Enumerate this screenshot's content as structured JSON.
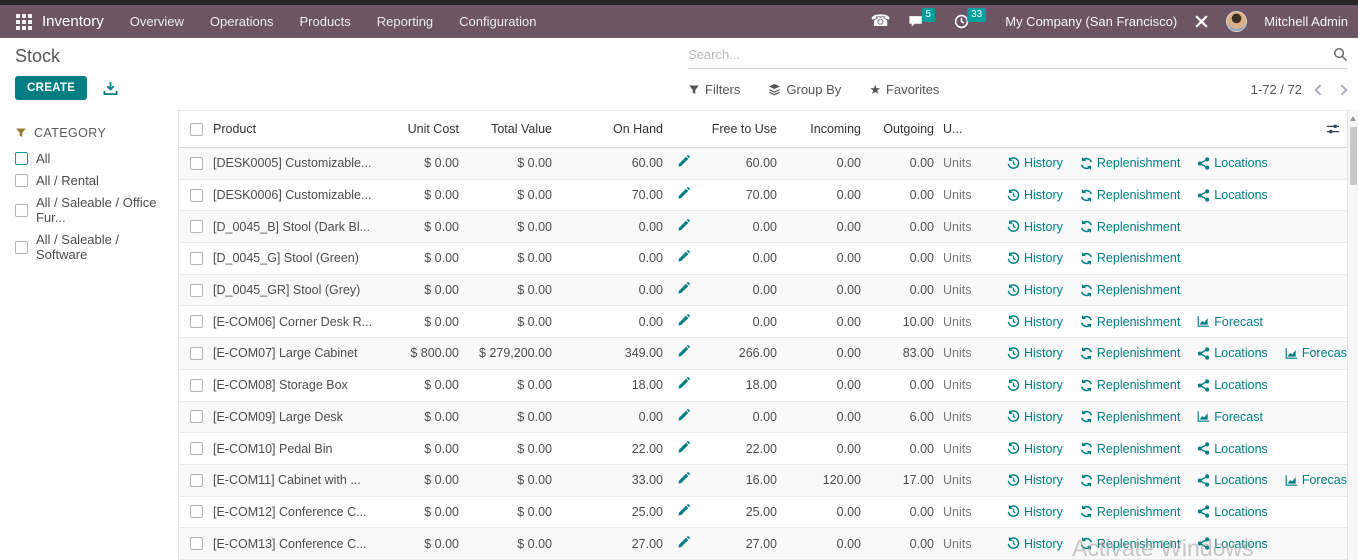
{
  "colors": {
    "topbar": "#6d5566",
    "accent": "#017e84",
    "badge": "#00a09d",
    "gold": "#9a7b2d"
  },
  "topbar": {
    "app_name": "Inventory",
    "menus": [
      "Overview",
      "Operations",
      "Products",
      "Reporting",
      "Configuration"
    ],
    "messages_badge": "5",
    "activities_badge": "33",
    "company": "My Company (San Francisco)",
    "user": "Mitchell Admin"
  },
  "control_panel": {
    "title": "Stock",
    "create_label": "CREATE",
    "search_placeholder": "Search...",
    "filters_label": "Filters",
    "group_by_label": "Group By",
    "favorites_label": "Favorites",
    "pager": "1-72 / 72"
  },
  "sidebar": {
    "title": "CATEGORY",
    "items": [
      {
        "label": "All"
      },
      {
        "label": "All / Rental"
      },
      {
        "label": "All / Saleable / Office Fur..."
      },
      {
        "label": "All / Saleable / Software"
      }
    ]
  },
  "table": {
    "columns": {
      "product": "Product",
      "unit_cost": "Unit Cost",
      "total_value": "Total Value",
      "on_hand": "On Hand",
      "free_to_use": "Free to Use",
      "incoming": "Incoming",
      "outgoing": "Outgoing",
      "uom": "U..."
    },
    "uom_value": "Units",
    "action_labels": {
      "history": "History",
      "replenishment": "Replenishment",
      "locations": "Locations",
      "forecast": "Forecast"
    },
    "rows": [
      {
        "product": "[DESK0005] Customizable...",
        "unit_cost": "$ 0.00",
        "total_value": "$ 0.00",
        "on_hand": "60.00",
        "free_to_use": "60.00",
        "incoming": "0.00",
        "outgoing": "0.00",
        "actions": [
          "history",
          "replenishment",
          "locations"
        ]
      },
      {
        "product": "[DESK0006] Customizable...",
        "unit_cost": "$ 0.00",
        "total_value": "$ 0.00",
        "on_hand": "70.00",
        "free_to_use": "70.00",
        "incoming": "0.00",
        "outgoing": "0.00",
        "actions": [
          "history",
          "replenishment",
          "locations"
        ]
      },
      {
        "product": "[D_0045_B] Stool (Dark Bl...",
        "unit_cost": "$ 0.00",
        "total_value": "$ 0.00",
        "on_hand": "0.00",
        "free_to_use": "0.00",
        "incoming": "0.00",
        "outgoing": "0.00",
        "actions": [
          "history",
          "replenishment"
        ]
      },
      {
        "product": "[D_0045_G] Stool (Green)",
        "unit_cost": "$ 0.00",
        "total_value": "$ 0.00",
        "on_hand": "0.00",
        "free_to_use": "0.00",
        "incoming": "0.00",
        "outgoing": "0.00",
        "actions": [
          "history",
          "replenishment"
        ]
      },
      {
        "product": "[D_0045_GR] Stool (Grey)",
        "unit_cost": "$ 0.00",
        "total_value": "$ 0.00",
        "on_hand": "0.00",
        "free_to_use": "0.00",
        "incoming": "0.00",
        "outgoing": "0.00",
        "actions": [
          "history",
          "replenishment"
        ]
      },
      {
        "product": "[E-COM06] Corner Desk R...",
        "unit_cost": "$ 0.00",
        "total_value": "$ 0.00",
        "on_hand": "0.00",
        "free_to_use": "0.00",
        "incoming": "0.00",
        "outgoing": "10.00",
        "actions": [
          "history",
          "replenishment",
          "forecast"
        ]
      },
      {
        "product": "[E-COM07] Large Cabinet",
        "unit_cost": "$ 800.00",
        "total_value": "$ 279,200.00",
        "on_hand": "349.00",
        "free_to_use": "266.00",
        "incoming": "0.00",
        "outgoing": "83.00",
        "actions": [
          "history",
          "replenishment",
          "locations",
          "forecast"
        ]
      },
      {
        "product": "[E-COM08] Storage Box",
        "unit_cost": "$ 0.00",
        "total_value": "$ 0.00",
        "on_hand": "18.00",
        "free_to_use": "18.00",
        "incoming": "0.00",
        "outgoing": "0.00",
        "actions": [
          "history",
          "replenishment",
          "locations"
        ]
      },
      {
        "product": "[E-COM09] Large Desk",
        "unit_cost": "$ 0.00",
        "total_value": "$ 0.00",
        "on_hand": "0.00",
        "free_to_use": "0.00",
        "incoming": "0.00",
        "outgoing": "6.00",
        "actions": [
          "history",
          "replenishment",
          "forecast"
        ]
      },
      {
        "product": "[E-COM10] Pedal Bin",
        "unit_cost": "$ 0.00",
        "total_value": "$ 0.00",
        "on_hand": "22.00",
        "free_to_use": "22.00",
        "incoming": "0.00",
        "outgoing": "0.00",
        "actions": [
          "history",
          "replenishment",
          "locations"
        ]
      },
      {
        "product": "[E-COM11] Cabinet with ...",
        "unit_cost": "$ 0.00",
        "total_value": "$ 0.00",
        "on_hand": "33.00",
        "free_to_use": "16.00",
        "incoming": "120.00",
        "outgoing": "17.00",
        "actions": [
          "history",
          "replenishment",
          "locations",
          "forecast"
        ]
      },
      {
        "product": "[E-COM12] Conference C...",
        "unit_cost": "$ 0.00",
        "total_value": "$ 0.00",
        "on_hand": "25.00",
        "free_to_use": "25.00",
        "incoming": "0.00",
        "outgoing": "0.00",
        "actions": [
          "history",
          "replenishment",
          "locations"
        ]
      },
      {
        "product": "[E-COM13] Conference C...",
        "unit_cost": "$ 0.00",
        "total_value": "$ 0.00",
        "on_hand": "27.00",
        "free_to_use": "27.00",
        "incoming": "0.00",
        "outgoing": "0.00",
        "actions": [
          "history",
          "replenishment",
          "locations"
        ]
      }
    ]
  },
  "watermark": "Activate Windows"
}
